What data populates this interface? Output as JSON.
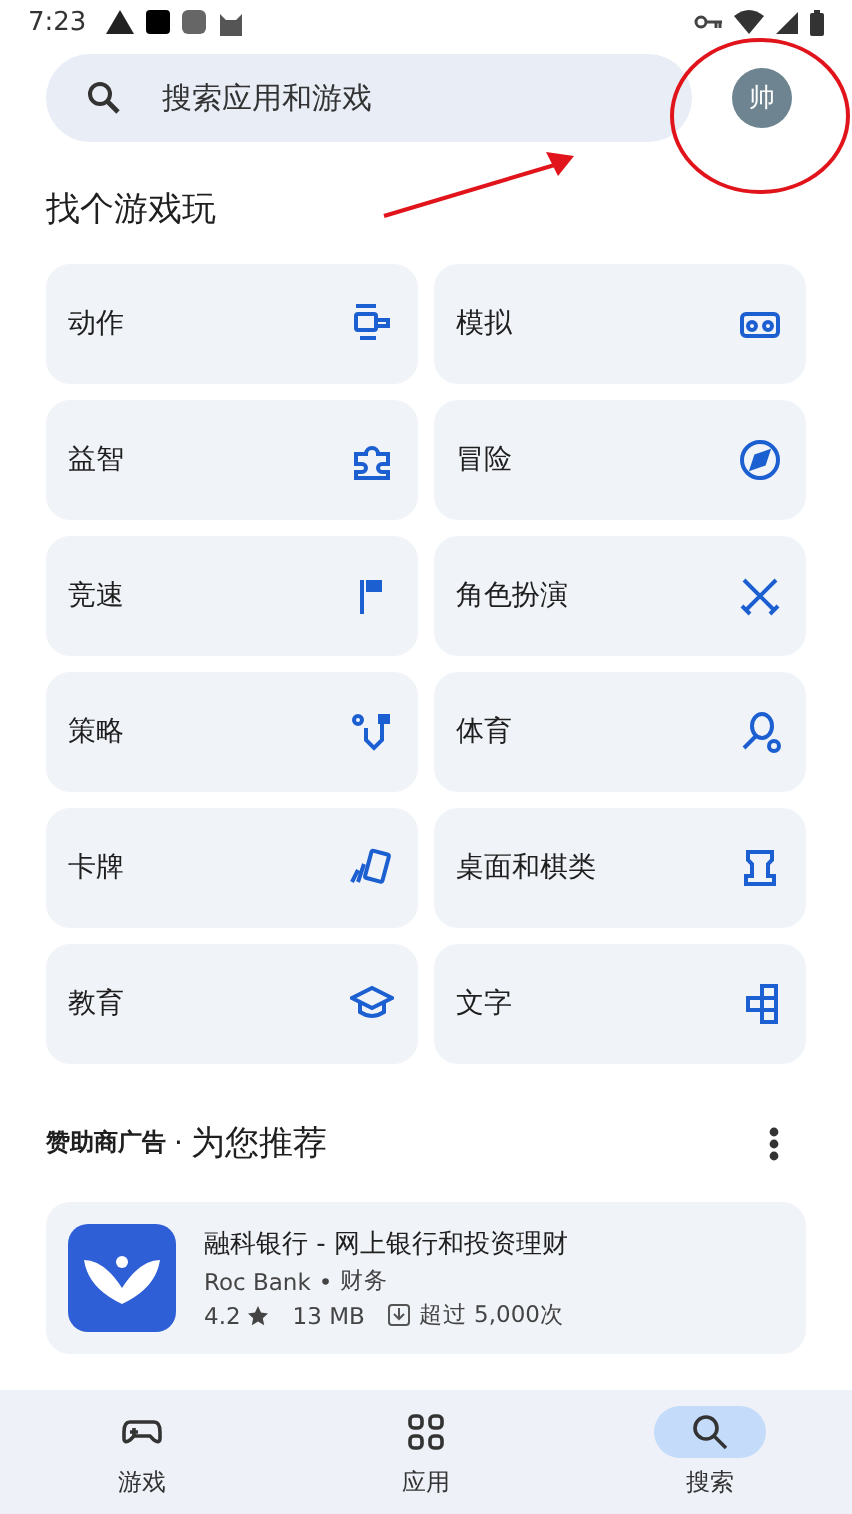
{
  "status_bar": {
    "time": "7:23"
  },
  "search": {
    "placeholder": "搜索应用和游戏"
  },
  "account": {
    "avatar_letter": "帅"
  },
  "section_title": "找个游戏玩",
  "categories": [
    {
      "label": "动作"
    },
    {
      "label": "模拟"
    },
    {
      "label": "益智"
    },
    {
      "label": "冒险"
    },
    {
      "label": "竞速"
    },
    {
      "label": "角色扮演"
    },
    {
      "label": "策略"
    },
    {
      "label": "体育"
    },
    {
      "label": "卡牌"
    },
    {
      "label": "桌面和棋类"
    },
    {
      "label": "教育"
    },
    {
      "label": "文字"
    }
  ],
  "ads": {
    "sponsor_label": "赞助商广告",
    "separator": "·",
    "title": "为您推荐",
    "app": {
      "name": "融科银行 - 网上银行和投资理财",
      "developer": "Roc Bank",
      "separator": "•",
      "category": "财务",
      "rating": "4.2",
      "size": "13 MB",
      "downloads": "超过 5,000次"
    }
  },
  "bottom_nav": [
    {
      "label": "游戏",
      "selected": false
    },
    {
      "label": "应用",
      "selected": false
    },
    {
      "label": "搜索",
      "selected": true
    }
  ],
  "annotations": {
    "circle": true,
    "arrow": true
  }
}
